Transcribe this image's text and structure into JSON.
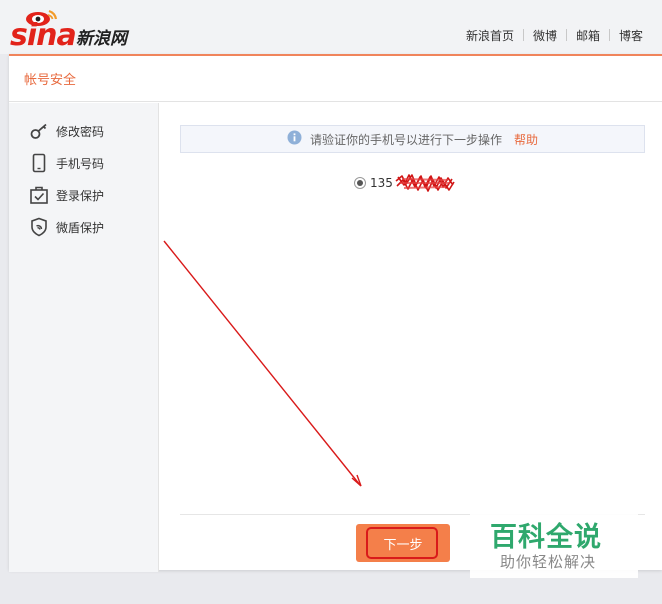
{
  "header": {
    "logo_text": "sina",
    "logo_cn": "新浪网",
    "nav": [
      "新浪首页",
      "微博",
      "邮箱",
      "博客"
    ]
  },
  "card": {
    "title": "帐号安全"
  },
  "sidebar": {
    "items": [
      {
        "label": "修改密码",
        "icon": "key-icon"
      },
      {
        "label": "手机号码",
        "icon": "phone-icon"
      },
      {
        "label": "登录保护",
        "icon": "login-protect-icon"
      },
      {
        "label": "微盾保护",
        "icon": "shield-icon"
      }
    ]
  },
  "content": {
    "notice_text": "请验证你的手机号以进行下一步操作",
    "help_link": "帮助",
    "phone_prefix": "135",
    "next_button": "下一步"
  },
  "watermark": {
    "line1": "百科全说",
    "line2": "助你轻松解决"
  },
  "colors": {
    "accent": "#e86a3e",
    "button": "#f47f4a",
    "logo_red": "#e2231a",
    "watermark_green": "#2fa86d",
    "annotation_red": "#d91a1a"
  }
}
